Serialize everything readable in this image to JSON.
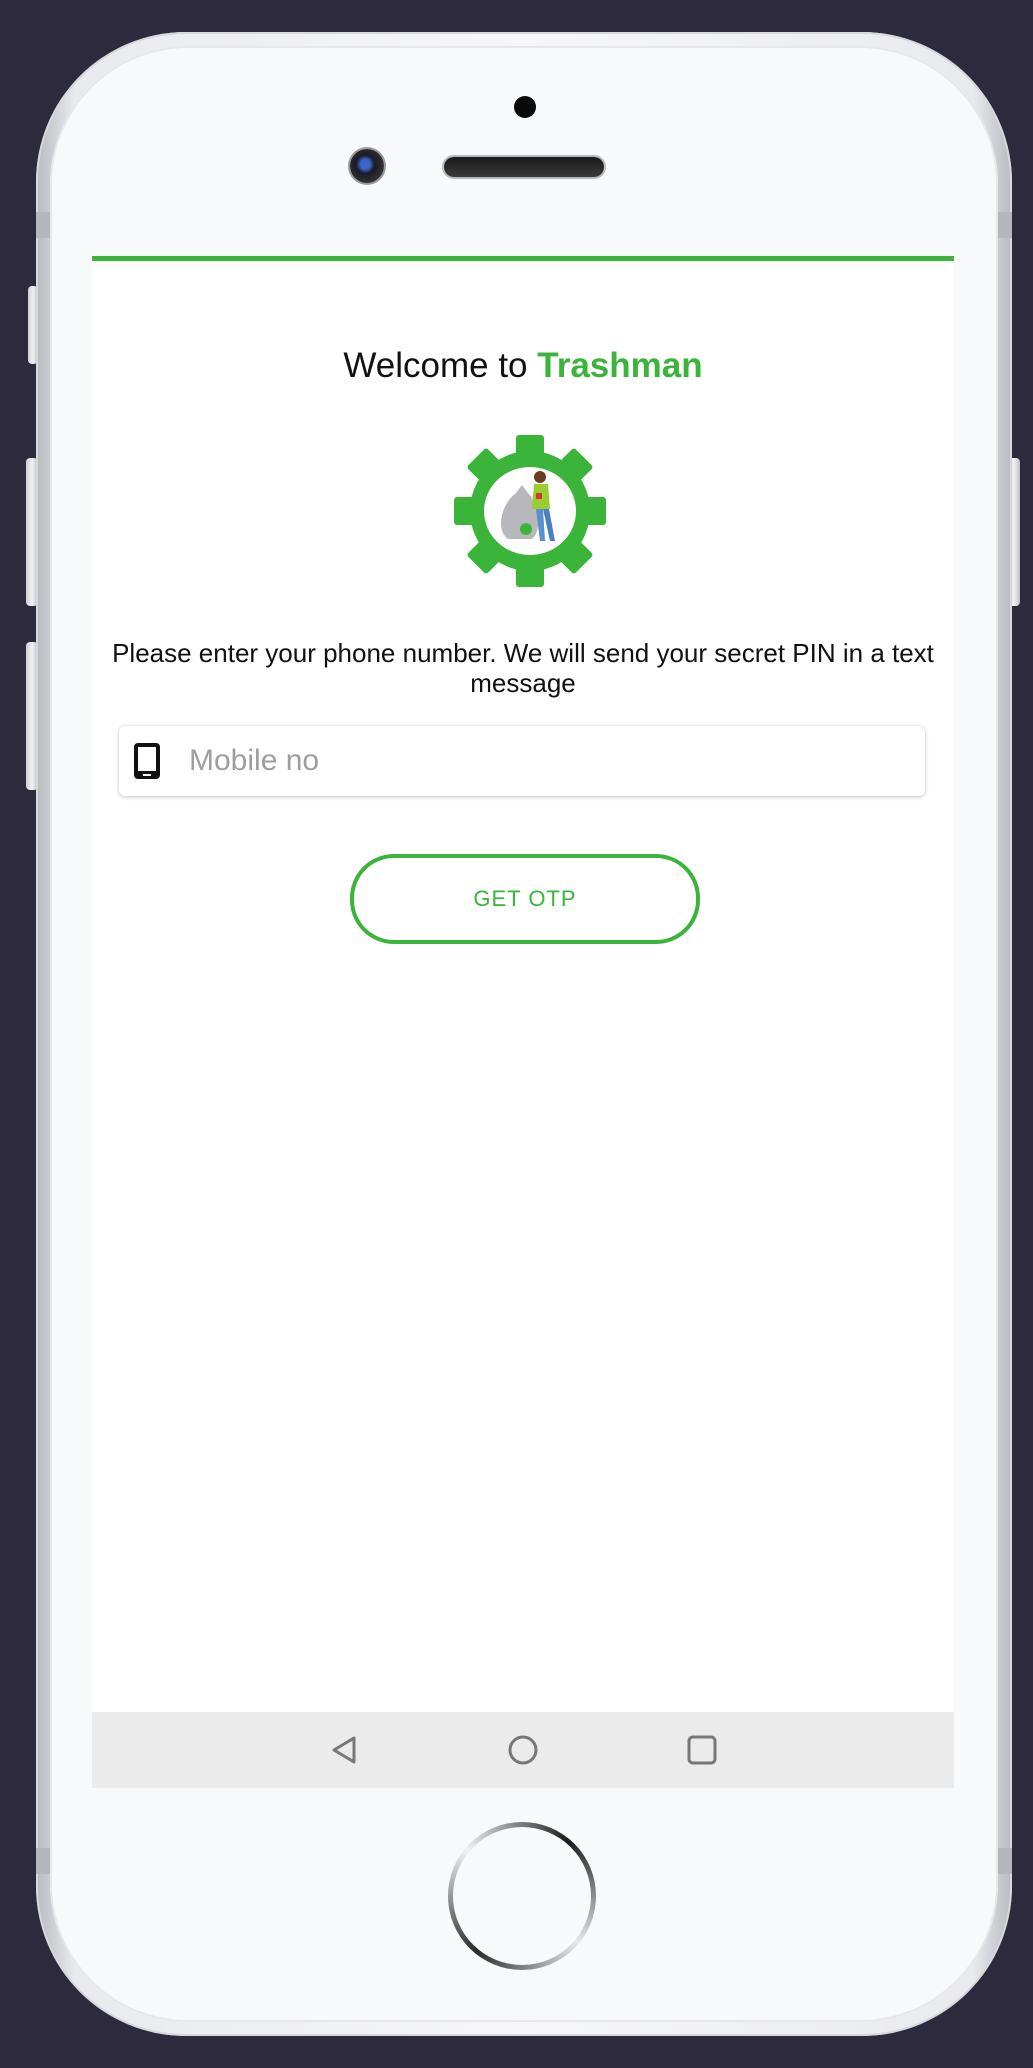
{
  "welcome": {
    "prefix": "Welcome to ",
    "brand": "Trashman"
  },
  "logo": {
    "icon": "gear-with-trash-collector"
  },
  "instruction": "Please enter your phone number. We will send your secret PIN in a text message",
  "mobile_field": {
    "icon": "mobile-phone-icon",
    "placeholder": "Mobile no",
    "value": ""
  },
  "otp_button": {
    "label": "GET OTP"
  },
  "nav_bar": {
    "icons": [
      "back-triangle-icon",
      "home-circle-icon",
      "recents-square-icon"
    ]
  },
  "colors": {
    "accent": "#3ab53a",
    "background": "#2e2a3d",
    "nav_bar": "#ebebeb"
  }
}
